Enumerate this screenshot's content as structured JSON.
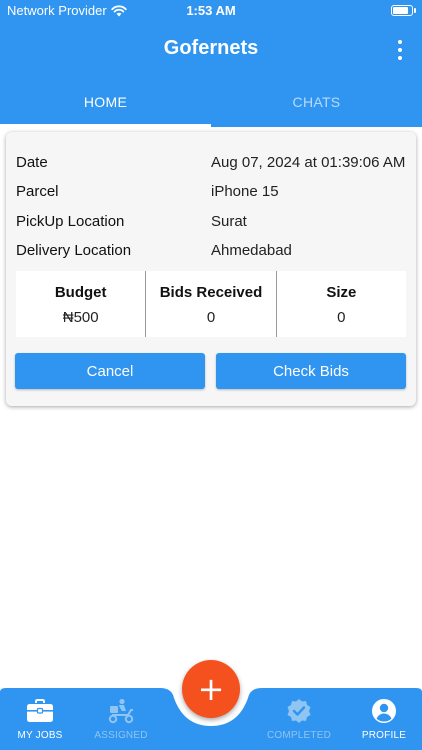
{
  "status_bar": {
    "carrier": "Network Provider",
    "time": "1:53 AM"
  },
  "header": {
    "title": "Gofernets",
    "menu_icon": "more-vert-icon"
  },
  "tabs": [
    {
      "label": "HOME",
      "active": true
    },
    {
      "label": "CHATS",
      "active": false
    }
  ],
  "job": {
    "rows": [
      {
        "label": "Date",
        "value": "Aug 07, 2024 at 01:39:06 AM"
      },
      {
        "label": "Parcel",
        "value": "iPhone 15"
      },
      {
        "label": "PickUp Location",
        "value": "Surat"
      },
      {
        "label": "Delivery Location",
        "value": "Ahmedabad"
      }
    ],
    "stats": [
      {
        "label": "Budget",
        "value": "₦500"
      },
      {
        "label": "Bids Received",
        "value": "0"
      },
      {
        "label": "Size",
        "value": "0"
      }
    ],
    "buttons": {
      "cancel": "Cancel",
      "check_bids": "Check Bids"
    }
  },
  "fab": {
    "label": "+"
  },
  "bottom_nav": [
    {
      "label": "MY JOBS",
      "icon": "briefcase-icon",
      "active": true
    },
    {
      "label": "ASSIGNED",
      "icon": "delivery-scooter-icon",
      "active": false
    },
    {
      "label": "COMPLETED",
      "icon": "verified-badge-icon",
      "active": false
    },
    {
      "label": "PROFILE",
      "icon": "account-circle-icon",
      "active": false
    }
  ],
  "colors": {
    "primary": "#2f95f1",
    "fab": "#f4511e",
    "card_bg": "#f6f6f6"
  }
}
